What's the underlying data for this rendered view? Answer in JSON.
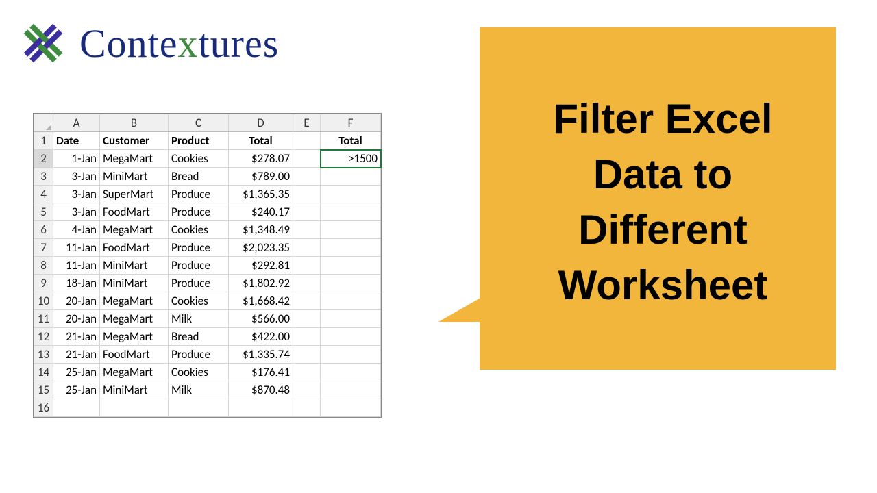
{
  "brand": {
    "name_pre": "Conte",
    "name_x": "x",
    "name_post": "tures"
  },
  "callout": {
    "text": "Filter Excel Data to Different Worksheet"
  },
  "sheet": {
    "columns": [
      "A",
      "B",
      "C",
      "D",
      "E",
      "F"
    ],
    "header_row_num": "1",
    "headers": {
      "A": "Date",
      "B": "Customer",
      "C": "Product",
      "D": "Total",
      "F": "Total"
    },
    "criteria": {
      "row": "2",
      "F": ">1500"
    },
    "rows": [
      {
        "n": "2",
        "A": "1-Jan",
        "B": "MegaMart",
        "C": "Cookies",
        "D": "$278.07"
      },
      {
        "n": "3",
        "A": "3-Jan",
        "B": "MiniMart",
        "C": "Bread",
        "D": "$789.00"
      },
      {
        "n": "4",
        "A": "3-Jan",
        "B": "SuperMart",
        "C": "Produce",
        "D": "$1,365.35"
      },
      {
        "n": "5",
        "A": "3-Jan",
        "B": "FoodMart",
        "C": "Produce",
        "D": "$240.17"
      },
      {
        "n": "6",
        "A": "4-Jan",
        "B": "MegaMart",
        "C": "Cookies",
        "D": "$1,348.49"
      },
      {
        "n": "7",
        "A": "11-Jan",
        "B": "FoodMart",
        "C": "Produce",
        "D": "$2,023.35"
      },
      {
        "n": "8",
        "A": "11-Jan",
        "B": "MiniMart",
        "C": "Produce",
        "D": "$292.81"
      },
      {
        "n": "9",
        "A": "18-Jan",
        "B": "MiniMart",
        "C": "Produce",
        "D": "$1,802.92"
      },
      {
        "n": "10",
        "A": "20-Jan",
        "B": "MegaMart",
        "C": "Cookies",
        "D": "$1,668.42"
      },
      {
        "n": "11",
        "A": "20-Jan",
        "B": "MegaMart",
        "C": "Milk",
        "D": "$566.00"
      },
      {
        "n": "12",
        "A": "21-Jan",
        "B": "MegaMart",
        "C": "Bread",
        "D": "$422.00"
      },
      {
        "n": "13",
        "A": "21-Jan",
        "B": "FoodMart",
        "C": "Produce",
        "D": "$1,335.74"
      },
      {
        "n": "14",
        "A": "25-Jan",
        "B": "MegaMart",
        "C": "Cookies",
        "D": "$176.41"
      },
      {
        "n": "15",
        "A": "25-Jan",
        "B": "MiniMart",
        "C": "Milk",
        "D": "$870.48"
      }
    ],
    "empty_row": "16"
  }
}
